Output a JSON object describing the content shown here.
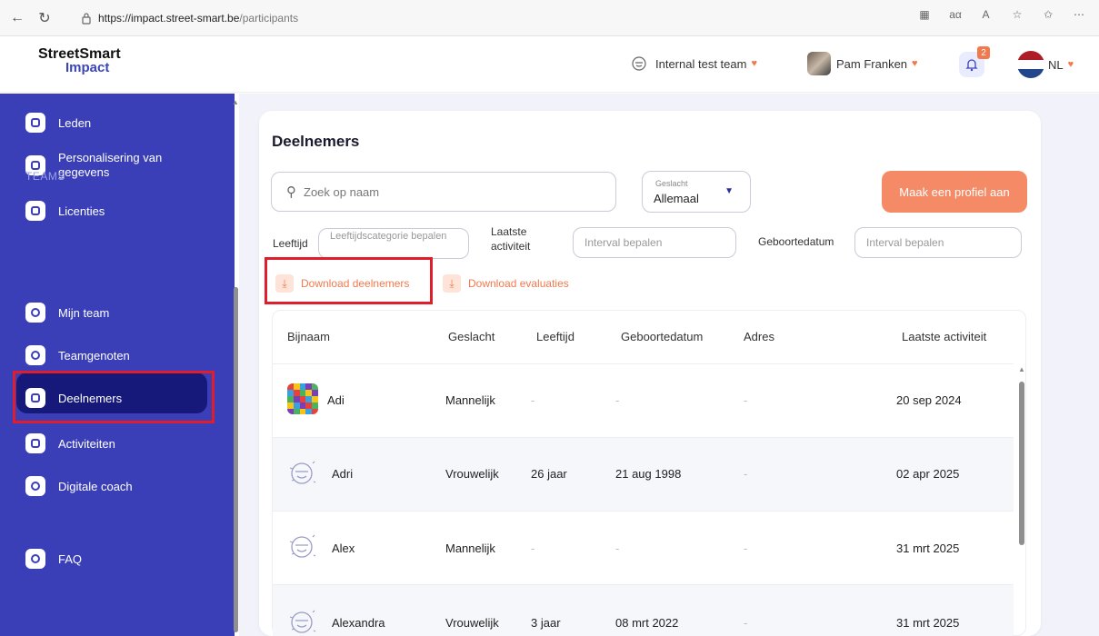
{
  "browser": {
    "url_host": "https://impact.street-smart.be",
    "url_path": "/participants"
  },
  "header": {
    "logo_line1": "StreetSmart",
    "logo_line2": "Impact",
    "team_name": "Internal test team",
    "user_name": "Pam Franken",
    "notification_count": "2",
    "language": "NL"
  },
  "sidebar": {
    "items_top": [
      {
        "label": "Leden"
      },
      {
        "label": "Personalisering van gegevens"
      },
      {
        "label": "Licenties"
      }
    ],
    "section_label": "TEAMS",
    "items_teams": [
      {
        "label": "Mijn team"
      },
      {
        "label": "Teamgenoten"
      },
      {
        "label": "Deelnemers"
      },
      {
        "label": "Activiteiten"
      },
      {
        "label": "Digitale coach"
      }
    ],
    "faq_label": "FAQ",
    "active_item": "Deelnemers"
  },
  "main": {
    "title": "Deelnemers",
    "search_placeholder": "Zoek op naam",
    "gender_filter": {
      "label": "Geslacht",
      "value": "Allemaal"
    },
    "create_button": "Maak een profiel aan",
    "filters": {
      "age_label": "Leeftijd",
      "age_placeholder": "Leeftijdscategorie bepalen",
      "last_activity_label": "Laatste activiteit",
      "last_activity_placeholder": "Interval bepalen",
      "birthdate_label": "Geboortedatum",
      "birthdate_placeholder": "Interval bepalen"
    },
    "download_participants": "Download deelnemers",
    "download_evaluations": "Download evaluaties",
    "table": {
      "columns": [
        "Bijnaam",
        "Geslacht",
        "Leeftijd",
        "Geboortedatum",
        "Adres",
        "Laatste activiteit"
      ],
      "rows": [
        {
          "name": "Adi",
          "gender": "Mannelijk",
          "age": "-",
          "birthdate": "-",
          "address": "-",
          "last_activity": "20 sep 2024"
        },
        {
          "name": "Adri",
          "gender": "Vrouwelijk",
          "age": "26 jaar",
          "birthdate": "21 aug 1998",
          "address": "-",
          "last_activity": "02 apr 2025"
        },
        {
          "name": "Alex",
          "gender": "Mannelijk",
          "age": "-",
          "birthdate": "-",
          "address": "-",
          "last_activity": "31 mrt 2025"
        },
        {
          "name": "Alexandra",
          "gender": "Vrouwelijk",
          "age": "3 jaar",
          "birthdate": "08 mrt 2022",
          "address": "-",
          "last_activity": "31 mrt 2025"
        }
      ]
    }
  },
  "colors": {
    "sidebar": "#3a3fb7",
    "sidebar_active": "#16197a",
    "accent_orange": "#f58b66",
    "highlight_red": "#e01e2b"
  }
}
